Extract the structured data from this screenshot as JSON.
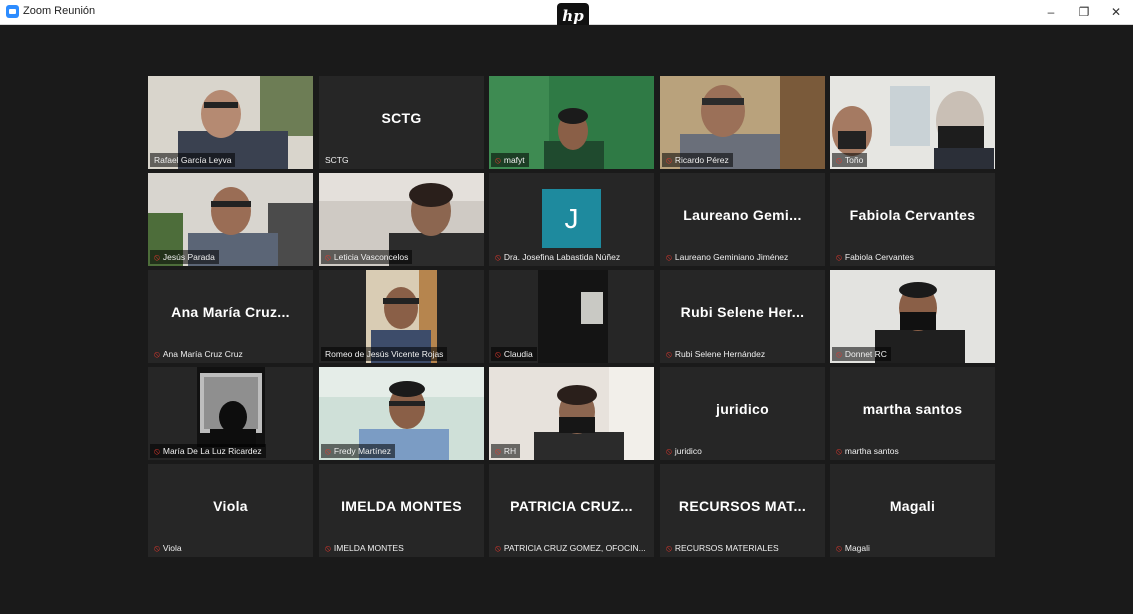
{
  "window": {
    "title": "Zoom Reunión",
    "minimize": "–",
    "maximize": "❐",
    "close": "✕"
  },
  "overlay": {
    "logo_text": "hp"
  },
  "colors": {
    "active_speaker_border": "#c5dc3c",
    "muted_mic": "#e0382e",
    "avatar_bg": "#1e8a9e",
    "tile_bg": "#262626"
  },
  "participants": [
    {
      "name": "Rafael García Leyva",
      "display": "",
      "muted": false,
      "active": true,
      "video": true
    },
    {
      "name": "SCTG",
      "display": "SCTG",
      "muted": false,
      "active": false,
      "video": false
    },
    {
      "name": "mafyt",
      "display": "",
      "muted": true,
      "active": false,
      "video": true
    },
    {
      "name": "Ricardo Pérez",
      "display": "",
      "muted": true,
      "active": false,
      "video": true
    },
    {
      "name": "Toño",
      "display": "",
      "muted": true,
      "active": false,
      "video": true
    },
    {
      "name": "Jesús Parada",
      "display": "",
      "muted": true,
      "active": false,
      "video": true
    },
    {
      "name": "Leticia Vasconcelos",
      "display": "",
      "muted": true,
      "active": false,
      "video": true
    },
    {
      "name": "Dra. Josefina Labastida Núñez",
      "display": "",
      "muted": true,
      "active": false,
      "video": false,
      "avatar": "J"
    },
    {
      "name": "Laureano Geminiano Jiménez",
      "display": "Laureano Gemi...",
      "muted": true,
      "active": false,
      "video": false
    },
    {
      "name": "Fabiola Cervantes",
      "display": "Fabiola Cervantes",
      "muted": true,
      "active": false,
      "video": false
    },
    {
      "name": "Ana María Cruz Cruz",
      "display": "Ana María Cruz...",
      "muted": true,
      "active": false,
      "video": false
    },
    {
      "name": "Romeo de Jesús Vicente Rojas",
      "display": "",
      "muted": false,
      "active": false,
      "video": true
    },
    {
      "name": "Claudia",
      "display": "",
      "muted": true,
      "active": false,
      "video": true
    },
    {
      "name": "Rubi Selene Hernández",
      "display": "Rubi Selene Her...",
      "muted": true,
      "active": false,
      "video": false
    },
    {
      "name": "Donnet RC",
      "display": "",
      "muted": true,
      "active": false,
      "video": true
    },
    {
      "name": "María De La Luz Ricardez",
      "display": "",
      "muted": true,
      "active": false,
      "video": true
    },
    {
      "name": "Fredy Martínez",
      "display": "",
      "muted": true,
      "active": false,
      "video": true
    },
    {
      "name": "RH",
      "display": "",
      "muted": true,
      "active": false,
      "video": true
    },
    {
      "name": "juridico",
      "display": "juridico",
      "muted": true,
      "active": false,
      "video": false
    },
    {
      "name": "martha santos",
      "display": "martha santos",
      "muted": true,
      "active": false,
      "video": false
    },
    {
      "name": "Viola",
      "display": "Viola",
      "muted": true,
      "active": false,
      "video": false
    },
    {
      "name": "IMELDA MONTES",
      "display": "IMELDA MONTES",
      "muted": true,
      "active": false,
      "video": false
    },
    {
      "name": "PATRICIA CRUZ GOMEZ, OFOCIN...",
      "display": "PATRICIA CRUZ...",
      "muted": true,
      "active": false,
      "video": false
    },
    {
      "name": "RECURSOS MATERIALES",
      "display": "RECURSOS MAT...",
      "muted": true,
      "active": false,
      "video": false
    },
    {
      "name": "Magali",
      "display": "Magali",
      "muted": true,
      "active": false,
      "video": false
    }
  ]
}
